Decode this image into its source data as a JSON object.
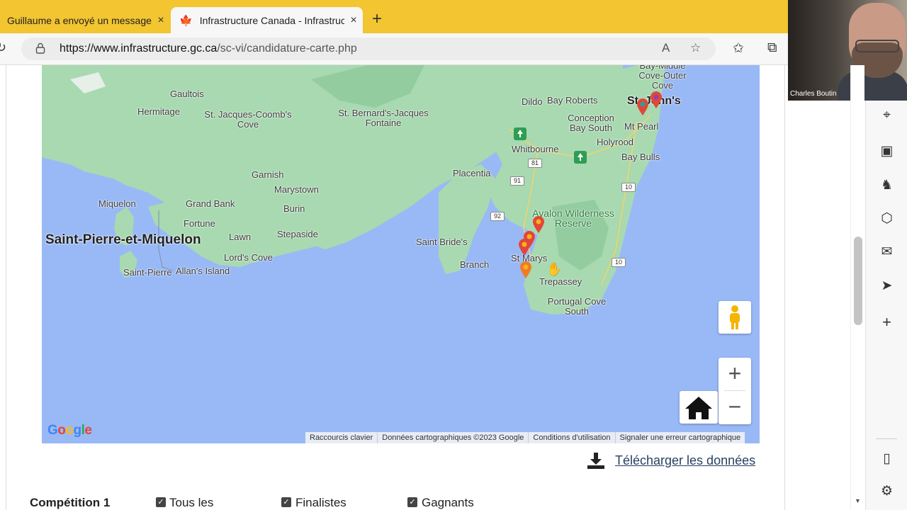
{
  "browser": {
    "tabs": [
      {
        "title": "Guillaume a envoyé un message",
        "close": "×"
      },
      {
        "title": "Infrastructure Canada - Infrastruc",
        "close": "×"
      }
    ],
    "new_tab": "+",
    "url_domain": "https://www.infrastructure.gc.ca",
    "url_path": "/sc-vi/candidature-carte.php"
  },
  "video_call": {
    "participant_name": "Charles Boutin"
  },
  "map": {
    "labels": {
      "bay_middle_cove": "Bay-Middle Cove-Outer Cove",
      "gaultois": "Gaultois",
      "hermitage": "Hermitage",
      "st_jacques": "St. Jacques-Coomb's Cove",
      "st_bernards": "St. Bernard's-Jacques Fontaine",
      "dildo": "Dildo",
      "bay_roberts": "Bay Roberts",
      "conception_bay_south": "Conception Bay South",
      "st_johns": "St. John's",
      "mt_pearl": "Mt Pearl",
      "whitbourne": "Whitbourne",
      "holyrood": "Holyrood",
      "bay_bulls": "Bay Bulls",
      "placentia": "Placentia",
      "garnish": "Garnish",
      "marystown": "Marystown",
      "miquelon": "Miquelon",
      "grand_bank": "Grand Bank",
      "burin": "Burin",
      "fortune": "Fortune",
      "saint_pierre_et_miquelon": "Saint-Pierre-et-Miquelon",
      "lawn": "Lawn",
      "stepaside": "Stepaside",
      "lords_cove": "Lord's Cove",
      "saint_pierre": "Saint-Pierre",
      "allans_island": "Allan's Island",
      "saint_brides": "Saint Bride's",
      "branch": "Branch",
      "avalon_wilderness": "Avalon Wilderness Reserve",
      "st_marys": "St Marys",
      "trepassey": "Trepassey",
      "portugal_cove_south": "Portugal Cove South"
    },
    "route_shields": [
      "81",
      "91",
      "92",
      "10",
      "10"
    ],
    "zoom_in": "+",
    "zoom_out": "−",
    "google_logo": "Google",
    "attribution": [
      "Raccourcis clavier",
      "Données cartographiques ©2023 Google",
      "Conditions d'utilisation",
      "Signaler une erreur cartographique"
    ],
    "colors": {
      "water": "#99b9f6",
      "land": "#a8d9b0",
      "pin_orange": "#f07b26",
      "pin_red": "#e2463a",
      "pin_teal": "#2aa198",
      "pin_purple": "#8e44ad"
    }
  },
  "download_link": "Télécharger les données",
  "filters": {
    "competition_label": "Compétition 1",
    "options": [
      "Tous les",
      "Finalistes",
      "Gagnants"
    ]
  }
}
